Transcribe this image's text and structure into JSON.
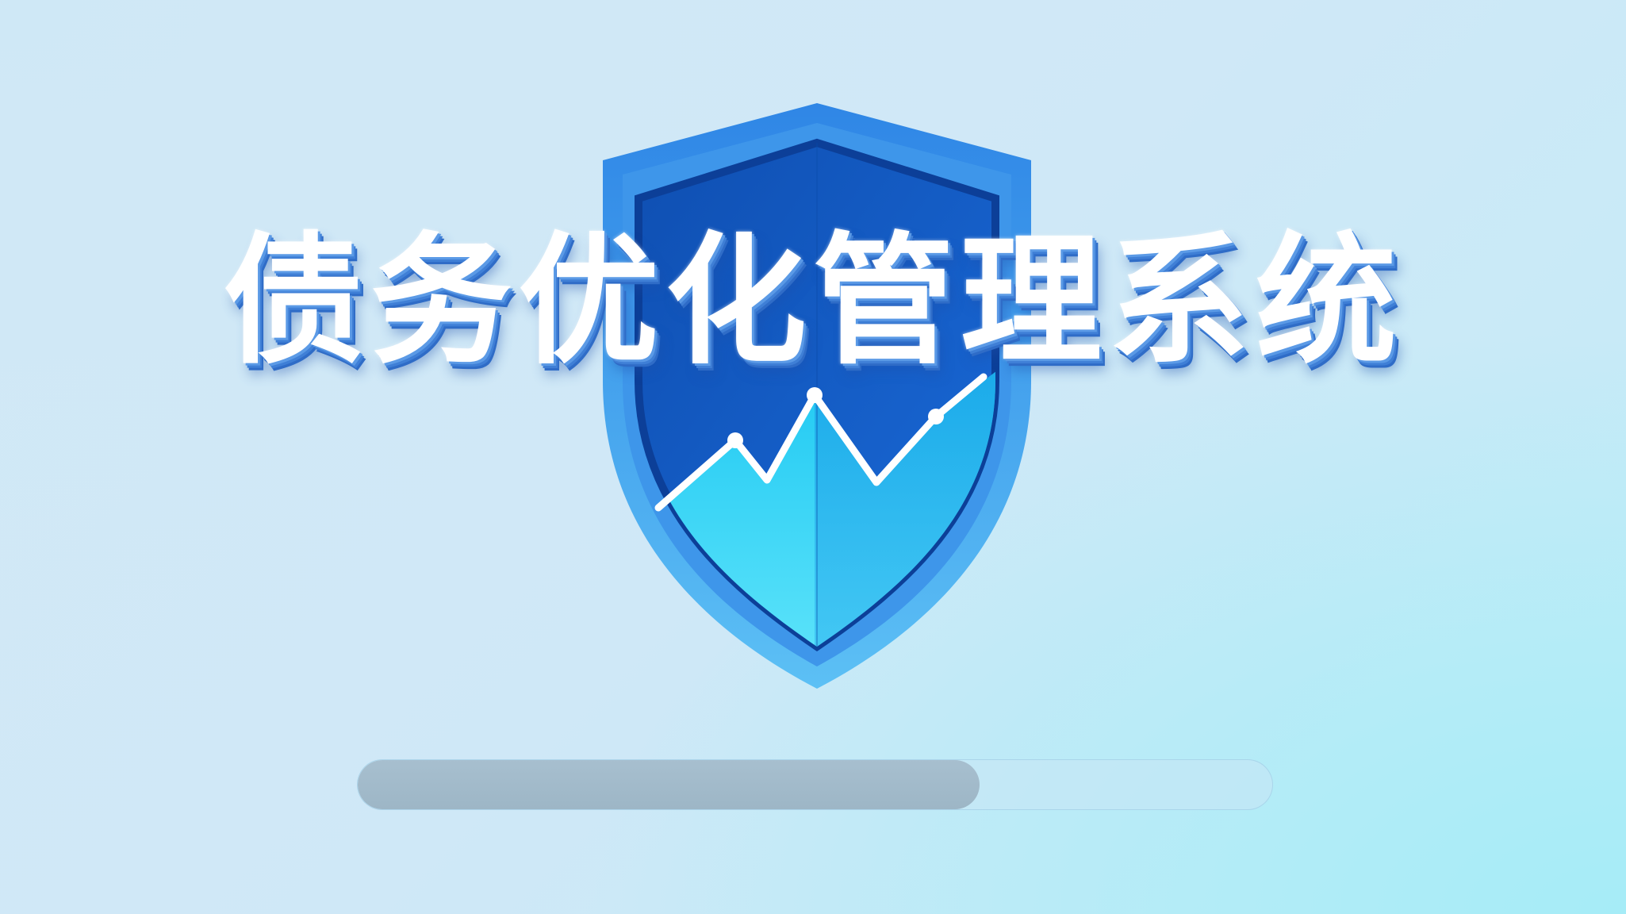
{
  "splash": {
    "title": "债务优化管理系统",
    "logo_icon": "shield-chart-icon",
    "progress": 0.68
  },
  "colors": {
    "shield_outer": "#4da6ef",
    "shield_inner": "#0e52b6",
    "chart_fill": "#2ad3f5",
    "progress_fill": "#a3bbca"
  }
}
